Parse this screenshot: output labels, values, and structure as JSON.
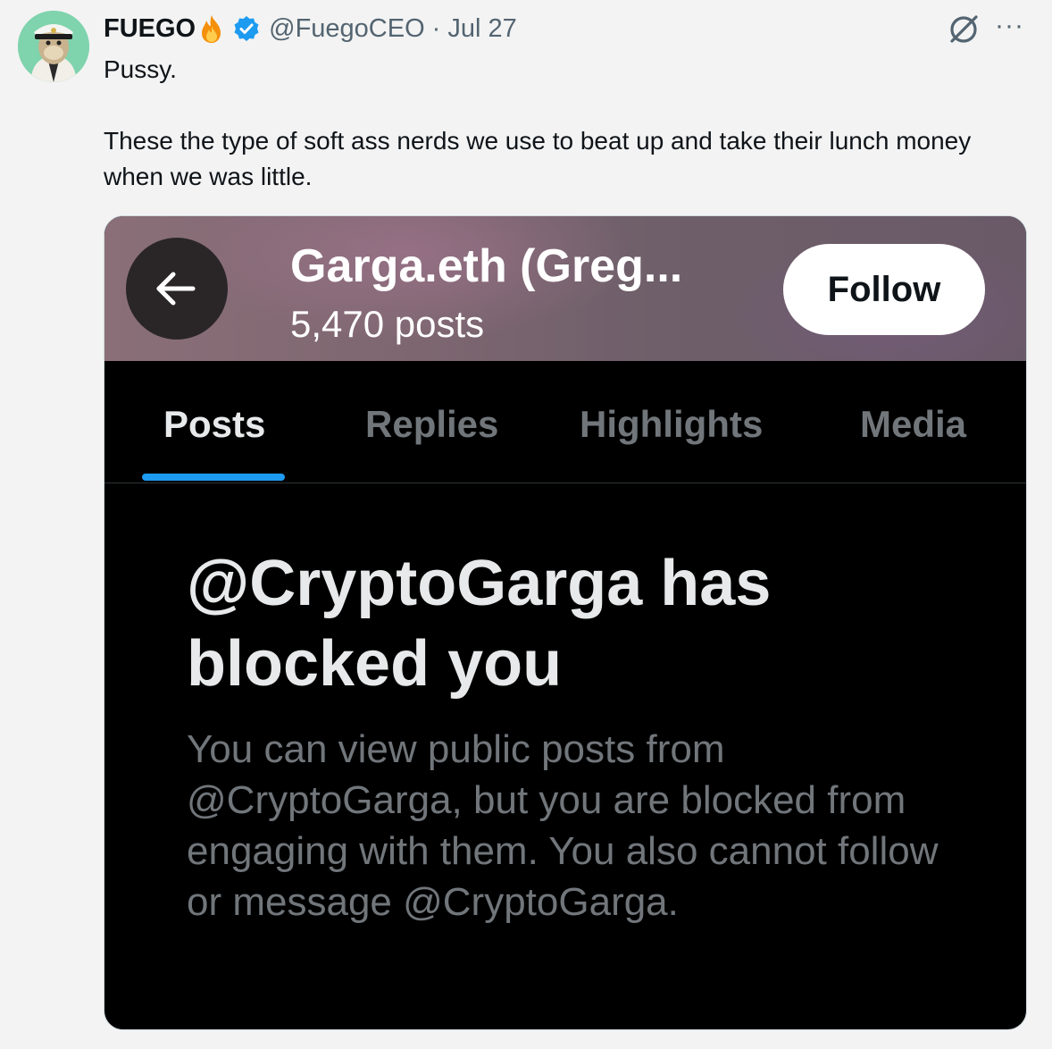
{
  "tweet": {
    "author_name": "FUEGO",
    "author_handle": "@FuegoCEO",
    "separator": "·",
    "date": "Jul 27",
    "text_line1": "Pussy.",
    "text_line2": "These the type of soft ass nerds we use to beat up and take their lunch money when we was little.",
    "more_label": "···"
  },
  "embedded": {
    "profile_name": "Garga.eth (Greg...",
    "post_count": "5,470 posts",
    "follow_label": "Follow",
    "tabs": [
      {
        "label": "Posts",
        "active": true
      },
      {
        "label": "Replies",
        "active": false
      },
      {
        "label": "Highlights",
        "active": false
      },
      {
        "label": "Media",
        "active": false
      }
    ],
    "blocked_title": "@CryptoGarga has blocked you",
    "blocked_desc": "You can view public posts from @CryptoGarga, but you are blocked from engaging with them. You also cannot follow or message @CryptoGarga."
  },
  "icons": {
    "avatar": "ape-captain-avatar",
    "fire": "fire-emoji-icon",
    "verified": "verified-badge-icon",
    "grok": "grok-icon",
    "more": "more-icon",
    "back": "arrow-left-icon"
  },
  "colors": {
    "accent": "#1d9bf0",
    "verified": "#1d9bf0",
    "muted_text": "#536471",
    "dark_bg": "#000000"
  }
}
